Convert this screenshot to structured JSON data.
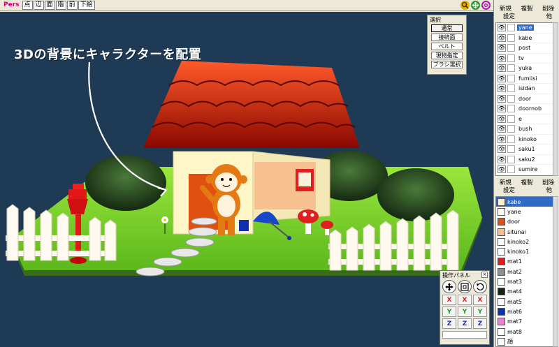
{
  "toolbar": {
    "mode": "Pers",
    "buttons": [
      "点",
      "辺",
      "面",
      "階",
      "前",
      "下絵"
    ],
    "right_icons": [
      "magnify-icon",
      "move-icon",
      "rotate-icon"
    ]
  },
  "viewport": {
    "caption": "3Dの背景にキャラクターを配置"
  },
  "selection_panel": {
    "title": "選択",
    "options": [
      "通常",
      "接続面",
      "ベルト",
      "現物指定",
      "ブラシ選択"
    ],
    "active": "通常"
  },
  "operation_panel": {
    "title": "操作パネル",
    "close": "×",
    "axes": [
      [
        "X",
        "X",
        "X"
      ],
      [
        "Y",
        "Y",
        "Y"
      ],
      [
        "Z",
        "Z",
        "Z"
      ]
    ]
  },
  "object_panel": {
    "menu_row1": [
      "新規",
      "複製",
      "削除"
    ],
    "menu_row2": [
      "設定",
      "他"
    ],
    "items": [
      "yane",
      "kabe",
      "post",
      "tv",
      "yuka",
      "fumiisi",
      "isidan",
      "door",
      "doornob",
      "e",
      "bush",
      "kinoko",
      "saku1",
      "saku2",
      "sumire"
    ],
    "selected": "yane"
  },
  "material_panel": {
    "menu_row1": [
      "新規",
      "複製",
      "削除"
    ],
    "menu_row2": [
      "設定",
      "他"
    ],
    "items": [
      {
        "name": "kabe",
        "color": "#fff0c8"
      },
      {
        "name": "yane",
        "color": "#ffffff"
      },
      {
        "name": "door",
        "color": "#e05010"
      },
      {
        "name": "situnai",
        "color": "#f6c090"
      },
      {
        "name": "kinoko2",
        "color": "#ffffff"
      },
      {
        "name": "kinoko1",
        "color": "#ffffff"
      },
      {
        "name": "mat1",
        "color": "#e02020"
      },
      {
        "name": "mat2",
        "color": "#909090"
      },
      {
        "name": "mat3",
        "color": "#ffffff"
      },
      {
        "name": "mat4",
        "color": "#142810"
      },
      {
        "name": "mat5",
        "color": "#ffffff"
      },
      {
        "name": "mat6",
        "color": "#1030b0"
      },
      {
        "name": "mat7",
        "color": "#f080d0"
      },
      {
        "name": "mat8",
        "color": "#ffffff"
      },
      {
        "name": "顔",
        "color": "#ffffff"
      }
    ],
    "selected": "kabe"
  },
  "colors": {
    "viewport_bg": "#1f3a54",
    "selection_highlight": "#316ac5",
    "grass": "#7fd42c",
    "roof": "#c01a06"
  }
}
